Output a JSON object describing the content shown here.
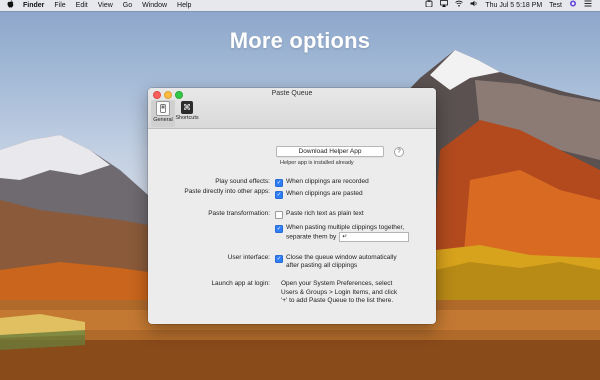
{
  "menubar": {
    "apple_icon": "apple-icon",
    "items": [
      "Finder",
      "File",
      "Edit",
      "View",
      "Go",
      "Window",
      "Help"
    ],
    "clock": "Thu Jul 5  5:18 PM",
    "user": "Test"
  },
  "heading": "More options",
  "window": {
    "title": "Paste Queue",
    "toolbar": [
      {
        "label": "General",
        "icon": "switch-icon",
        "active": true
      },
      {
        "label": "Shortcuts",
        "icon": "command-icon",
        "active": false
      }
    ],
    "paste_direct": {
      "label": "Paste directly into other apps:",
      "button": "Download Helper App",
      "help": "?",
      "note": "Helper app is installed already"
    },
    "sound": {
      "label": "Play sound effects:",
      "options": [
        {
          "text": "When clippings are recorded",
          "checked": true
        },
        {
          "text": "When clippings are pasted",
          "checked": true
        }
      ]
    },
    "transformation": {
      "label": "Paste transformation:",
      "options": [
        {
          "text": "Paste rich text as plain text",
          "checked": false
        },
        {
          "text_line1": "When pasting multiple clippings together,",
          "text_line2": "separate them by",
          "checked": true
        }
      ],
      "separator_value": "↵"
    },
    "interface": {
      "label": "User interface:",
      "line1": "Close the queue window automatically",
      "line2": "after pasting all clippings",
      "checked": true
    },
    "launch": {
      "label": "Launch app at login:",
      "line1": "Open your System Preferences, select",
      "line2": "Users & Groups > Login Items, and click",
      "line3": "'+' to add Paste Queue to the list there."
    }
  },
  "colors": {
    "accent": "#2f7df6",
    "heading": "#ffffff"
  }
}
